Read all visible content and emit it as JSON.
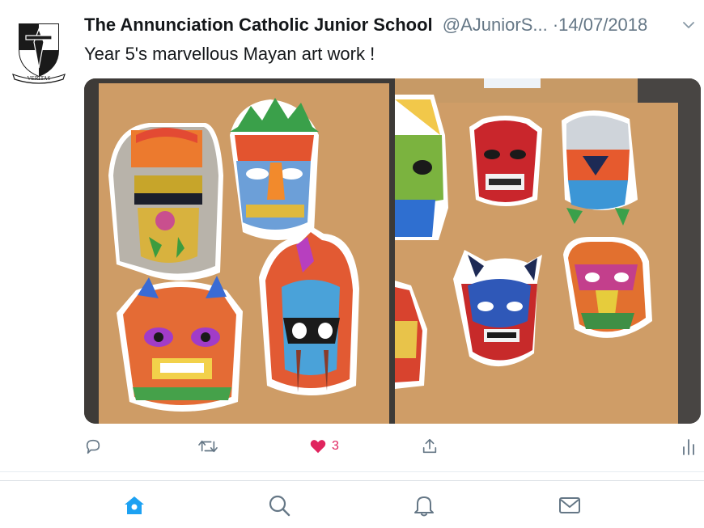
{
  "tweet": {
    "author_name": "The Annunciation Catholic Junior School",
    "author_handle": "@AJuniorS...",
    "separator": "·",
    "date": "14/07/2018",
    "text": "Year 5's marvellous Mayan art work !",
    "avatar_motto": "VERITAS",
    "like_count": "3"
  },
  "actions": {
    "icons": [
      "reply-icon",
      "retweet-icon",
      "heart-icon",
      "share-icon",
      "analytics-icon"
    ],
    "like_color": "#e0245e",
    "icon_color": "#657786"
  },
  "tabbar": {
    "icons": [
      "home-icon",
      "search-icon",
      "notifications-icon",
      "messages-icon"
    ],
    "active_color": "#1da1f2",
    "inactive_color": "#657786"
  }
}
